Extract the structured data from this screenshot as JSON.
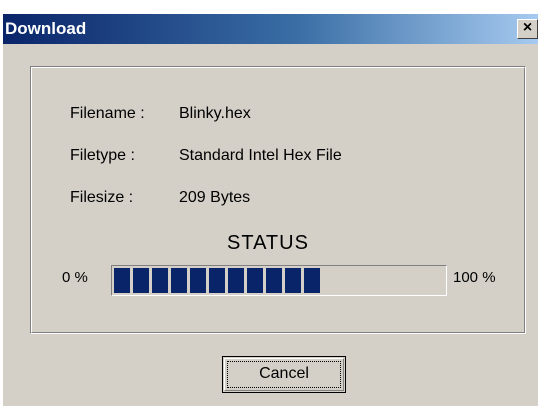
{
  "window": {
    "title": "Download",
    "close_glyph": "×"
  },
  "info": {
    "filename_label": "Filename :",
    "filename_value": "Blinky.hex",
    "filetype_label": "Filetype :",
    "filetype_value": "Standard Intel Hex File",
    "filesize_label": "Filesize :",
    "filesize_value": "209 Bytes"
  },
  "status": {
    "title": "STATUS",
    "min_label": "0 %",
    "max_label": "100 %",
    "progress_fraction": 0.62,
    "bar_color": "#0a246a"
  },
  "buttons": {
    "cancel_label": "Cancel"
  },
  "colors": {
    "face": "#d4d0c8",
    "titlebar_start": "#0a246a",
    "titlebar_end": "#a6caf0"
  }
}
